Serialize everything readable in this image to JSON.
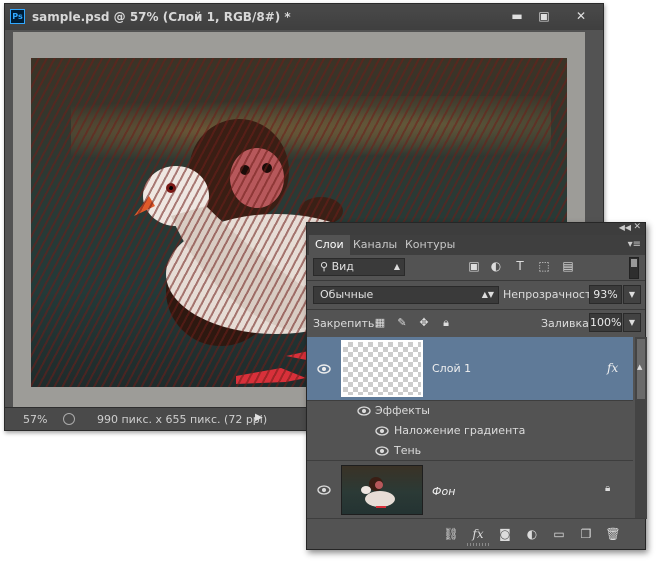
{
  "document": {
    "title": "sample.psd @ 57% (Слой 1, RGB/8#) *",
    "app_icon": "Ps",
    "window_controls": {
      "minimize": "▬",
      "maximize": "▣",
      "close": "✕"
    },
    "status": {
      "zoom": "57%",
      "info": "990 пикс. x 655 пикс. (72 ppi)",
      "arrow": "▶"
    }
  },
  "layers_panel": {
    "tabs": [
      {
        "label": "Слои",
        "active": true
      },
      {
        "label": "Каналы",
        "active": false
      },
      {
        "label": "Контуры",
        "active": false
      }
    ],
    "filter": {
      "value": "Вид"
    },
    "blend_mode": "Обычные",
    "opacity": {
      "label": "Непрозрачность:",
      "value": "93%"
    },
    "lock": {
      "label": "Закрепить:"
    },
    "fill": {
      "label": "Заливка:",
      "value": "100%"
    },
    "layers": [
      {
        "name": "Слой 1",
        "selected": true,
        "fx": "fx",
        "effects_label": "Эффекты",
        "effects": [
          "Наложение градиента",
          "Тень"
        ]
      },
      {
        "name": "Фон",
        "selected": false,
        "locked": true
      }
    ],
    "icons": {
      "filter_icons": [
        "image-filter-icon",
        "adjustment-filter-icon",
        "type-filter-icon",
        "shape-filter-icon",
        "smart-object-filter-icon"
      ],
      "lock_icons": [
        "lock-transparent-pixels-icon",
        "lock-image-pixels-icon",
        "lock-position-icon",
        "lock-all-icon"
      ],
      "footer_icons": [
        "link-layers-icon",
        "add-style-icon",
        "add-mask-icon",
        "new-adjustment-icon",
        "new-group-icon",
        "new-layer-icon",
        "delete-layer-icon"
      ]
    }
  },
  "colors": {
    "panel_bg": "#535353",
    "selected_layer": "#5f7a98",
    "tab_bar": "#3f3f3f"
  }
}
